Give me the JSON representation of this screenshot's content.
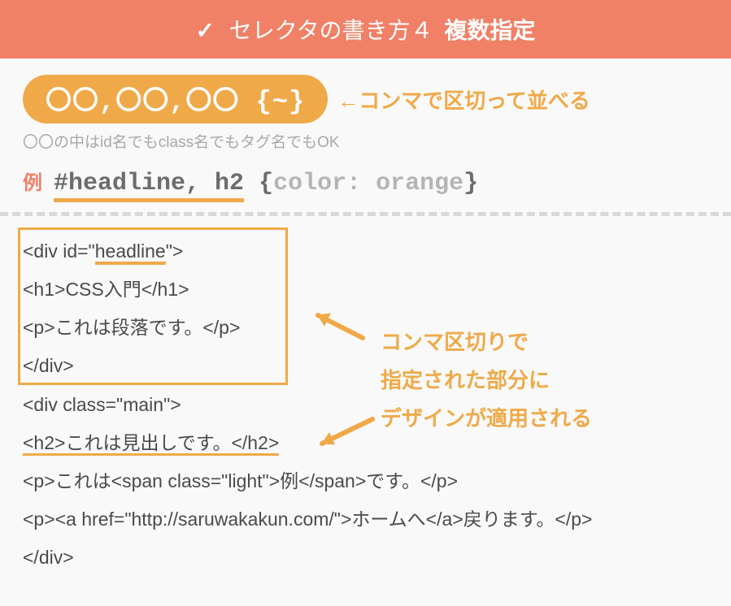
{
  "header": {
    "check": "✓",
    "titleLight": "セレクタの書き方４",
    "titleBold": "複数指定"
  },
  "pill": {
    "text": "〇〇,〇〇,〇〇 {~}",
    "arrowNote": "←コンマで区切って並べる"
  },
  "subnote": "〇〇の中はid名でもclass名でもタグ名でもOK",
  "example": {
    "label": "例",
    "selector": "#headline, h2",
    "brace1": "{",
    "rule": "color: orange",
    "brace2": "}"
  },
  "code": {
    "l1a": "<div id=\"",
    "l1b": "headline",
    "l1c": "\">",
    "l2": "<h1>CSS入門</h1>",
    "l3": "<p>これは段落です。</p>",
    "l4": "</div>",
    "l5": "<div class=\"main\">",
    "l6": "<h2>これは見出しです。</h2>",
    "l7": "<p>これは<span class=\"light\">例</span>です。</p>",
    "l8": "<p><a href=\"http://saruwakakun.com/\">ホームへ</a>戻ります。</p>",
    "l9": "</div>"
  },
  "annotation": {
    "l1": "コンマ区切りで",
    "l2": "指定された部分に",
    "l3": "デザインが適用される"
  }
}
